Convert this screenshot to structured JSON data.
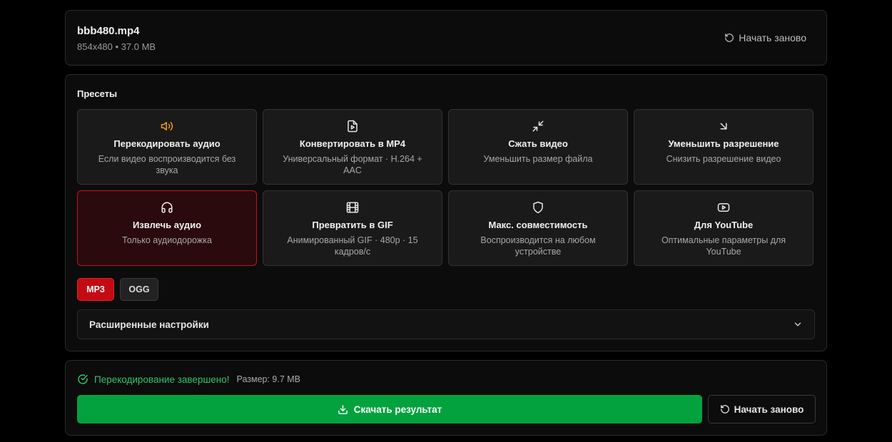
{
  "file": {
    "name": "bbb480.mp4",
    "meta": "854x480 • 37.0 MB",
    "restart_label": "Начать заново"
  },
  "presets": {
    "title": "Пресеты",
    "items": [
      {
        "icon": "speaker-icon",
        "title": "Перекодировать аудио",
        "desc": "Если видео воспроизводится без звука",
        "active": false,
        "icon_color": "#f59e0b"
      },
      {
        "icon": "file-video-icon",
        "title": "Конвертировать в MP4",
        "desc": "Универсальный формат · H.264 + AAC",
        "active": false
      },
      {
        "icon": "compress-icon",
        "title": "Сжать видео",
        "desc": "Уменьшить размер файла",
        "active": false
      },
      {
        "icon": "arrow-down-right-icon",
        "title": "Уменьшить разрешение",
        "desc": "Снизить разрешение видео",
        "active": false
      },
      {
        "icon": "headphones-icon",
        "title": "Извлечь аудио",
        "desc": "Только аудиодорожка",
        "active": true
      },
      {
        "icon": "film-icon",
        "title": "Превратить в GIF",
        "desc": "Анимированный GIF · 480p · 15 кадров/с",
        "active": false
      },
      {
        "icon": "shield-icon",
        "title": "Макс. совместимость",
        "desc": "Воспроизводится на любом устройстве",
        "active": false
      },
      {
        "icon": "youtube-icon",
        "title": "Для YouTube",
        "desc": "Оптимальные параметры для YouTube",
        "active": false
      }
    ]
  },
  "formats": [
    {
      "label": "MP3",
      "active": true
    },
    {
      "label": "OGG",
      "active": false
    }
  ],
  "advanced": {
    "label": "Расширенные настройки"
  },
  "result": {
    "status": "Перекодирование завершено!",
    "size": "Размер: 9.7 MB",
    "download_label": "Скачать результат",
    "restart_label": "Начать заново"
  },
  "colors": {
    "accent_red": "#c40a12",
    "success_green": "#03a23f",
    "status_green": "#31c46a",
    "warning_orange": "#f59e0b"
  }
}
